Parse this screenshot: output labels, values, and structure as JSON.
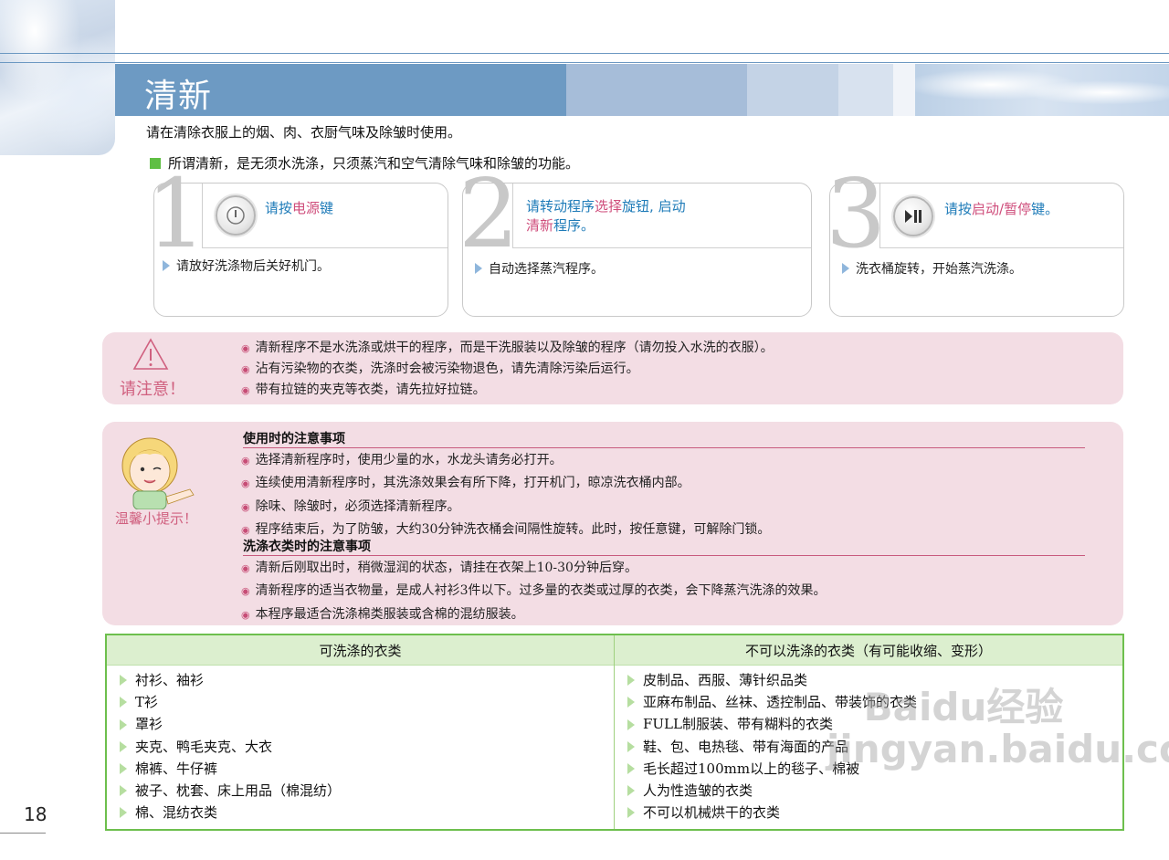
{
  "page": {
    "title": "清新",
    "intro": "请在清除衣服上的烟、肉、衣厨气味及除皱时使用。",
    "definition": "所谓清新，是无须水洗涤，只须蒸汽和空气清除气味和除皱的功能。",
    "page_number": "18"
  },
  "steps": [
    {
      "number": "1",
      "icon": "power-icon",
      "title_parts": [
        "请按",
        "电源",
        "键"
      ],
      "desc": "请放好洗涤物后关好机门。"
    },
    {
      "number": "2",
      "title_line1_parts": [
        "请转动程序",
        "选择",
        "旋钮, 启动"
      ],
      "title_line2_parts": [
        "清新",
        "程序。"
      ],
      "desc": "自动选择蒸汽程序。"
    },
    {
      "number": "3",
      "icon": "play-pause-icon",
      "title_parts": [
        "请按",
        "启动/暂停",
        "键。"
      ],
      "desc": "洗衣桶旋转，开始蒸汽洗涤。"
    }
  ],
  "caution": {
    "label": "请注意！",
    "icon": "warning-icon",
    "items": [
      "清新程序不是水洗涤或烘干的程序，而是干洗服装以及除皱的程序（请勿投入水洗的衣服）。",
      "沾有污染物的衣类，洗涤时会被污染物退色，请先清除污染后运行。",
      "带有拉链的夹克等衣类，请先拉好拉链。"
    ]
  },
  "tips": {
    "label": "温馨小提示！",
    "icon": "girl-mascot-icon",
    "section1_title": "使用时的注意事项",
    "section1_items": [
      "选择清新程序时，使用少量的水，水龙头请务必打开。",
      "连续使用清新程序时，其洗涤效果会有所下降，打开机门，晾凉洗衣桶内部。",
      "除味、除皱时，必须选择清新程序。",
      "程序结束后，为了防皱，大约30分钟洗衣桶会间隔性旋转。此时，按任意键，可解除门锁。"
    ],
    "section2_title": "洗涤衣类时的注意事项",
    "section2_items": [
      "清新后刚取出时，稍微湿润的状态，请挂在衣架上10-30分钟后穿。",
      "清新程序的适当衣物量，是成人衬衫3件以下。过多量的衣类或过厚的衣类，会下降蒸汽洗涤的效果。",
      "本程序最适合洗涤棉类服装或含棉的混纺服装。"
    ]
  },
  "table": {
    "header_left": "可洗涤的衣类",
    "header_right": "不可以洗涤的衣类（有可能收缩、变形）",
    "left_items": [
      "衬衫、袖衫",
      "T衫",
      "罩衫",
      "夹克、鸭毛夹克、大衣",
      "棉裤、牛仔裤",
      "被子、枕套、床上用品（棉混纺）",
      "棉、混纺衣类"
    ],
    "right_items": [
      "皮制品、西服、薄针织品类",
      "亚麻布制品、丝袜、透控制品、带装饰的衣类",
      "FULL制服装、带有糊料的衣类",
      "鞋、包、电热毯、带有海面的产品",
      "毛长超过100mm以上的毯子、棉被",
      "人为性造皱的衣类",
      "不可以机械烘干的衣类"
    ]
  },
  "watermark": "Baidu经验 jingyan.baidu.com",
  "colors": {
    "title_band": "#6d9ac3",
    "step_title": "#1e7bb8",
    "step_highlight": "#cf4d7b",
    "pink_panel": "#f3dde4",
    "table_border": "#6dbf4d",
    "table_header": "#dcefcf"
  }
}
